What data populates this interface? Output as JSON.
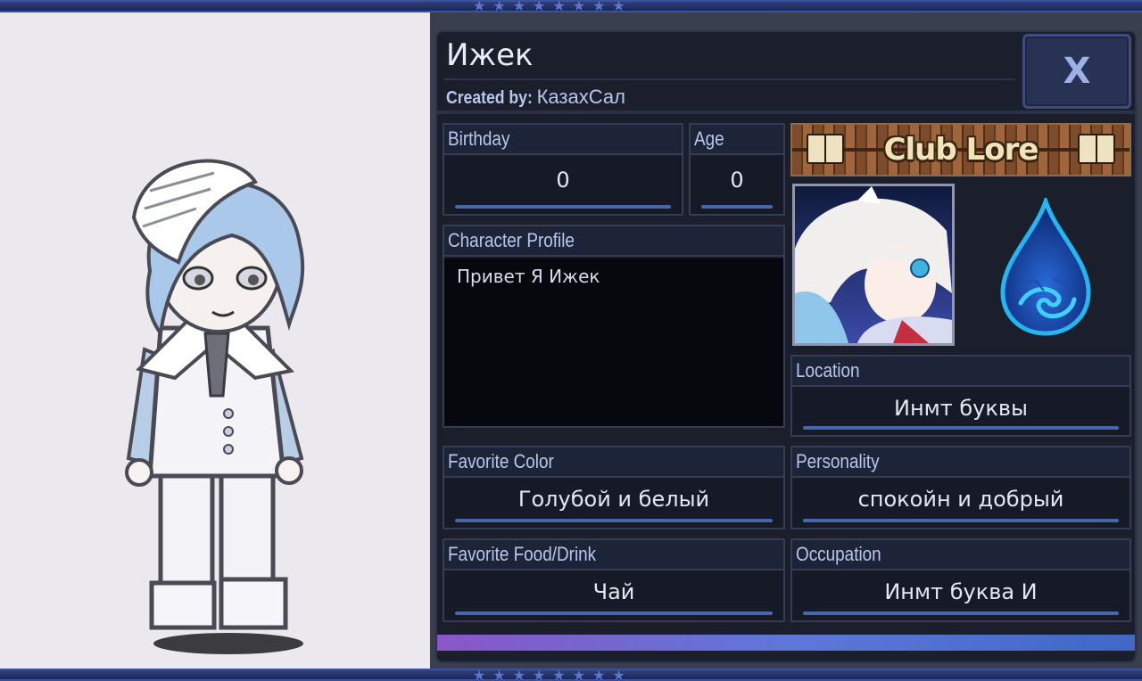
{
  "character": {
    "name": "Ижек",
    "created_label": "Created by: ",
    "creator": "КазахСал"
  },
  "close_button": {
    "label": "X"
  },
  "club_banner": {
    "label": "Club Lore",
    "icon": "book-icon"
  },
  "fields": {
    "birthday": {
      "label": "Birthday",
      "value": "0"
    },
    "age": {
      "label": "Age",
      "value": "0"
    },
    "profile": {
      "label": "Character Profile",
      "value": "Привет Я Ижек"
    },
    "location": {
      "label": "Location",
      "value": "Инмт буквы"
    },
    "favorite_color": {
      "label": "Favorite Color",
      "value": "Голубой и белый"
    },
    "personality": {
      "label": "Personality",
      "value": "спокойн и добрый"
    },
    "favorite_food": {
      "label": "Favorite Food/Drink",
      "value": "Чай"
    },
    "occupation": {
      "label": "Occupation",
      "value": "Инмт буква И"
    }
  },
  "icons": {
    "element": "water-drop-icon",
    "stars": "star-icon"
  },
  "colors": {
    "panel_bg": "#1b1f2c",
    "accent_blue": "#4a67ad",
    "label_text": "#b8c6ee"
  }
}
